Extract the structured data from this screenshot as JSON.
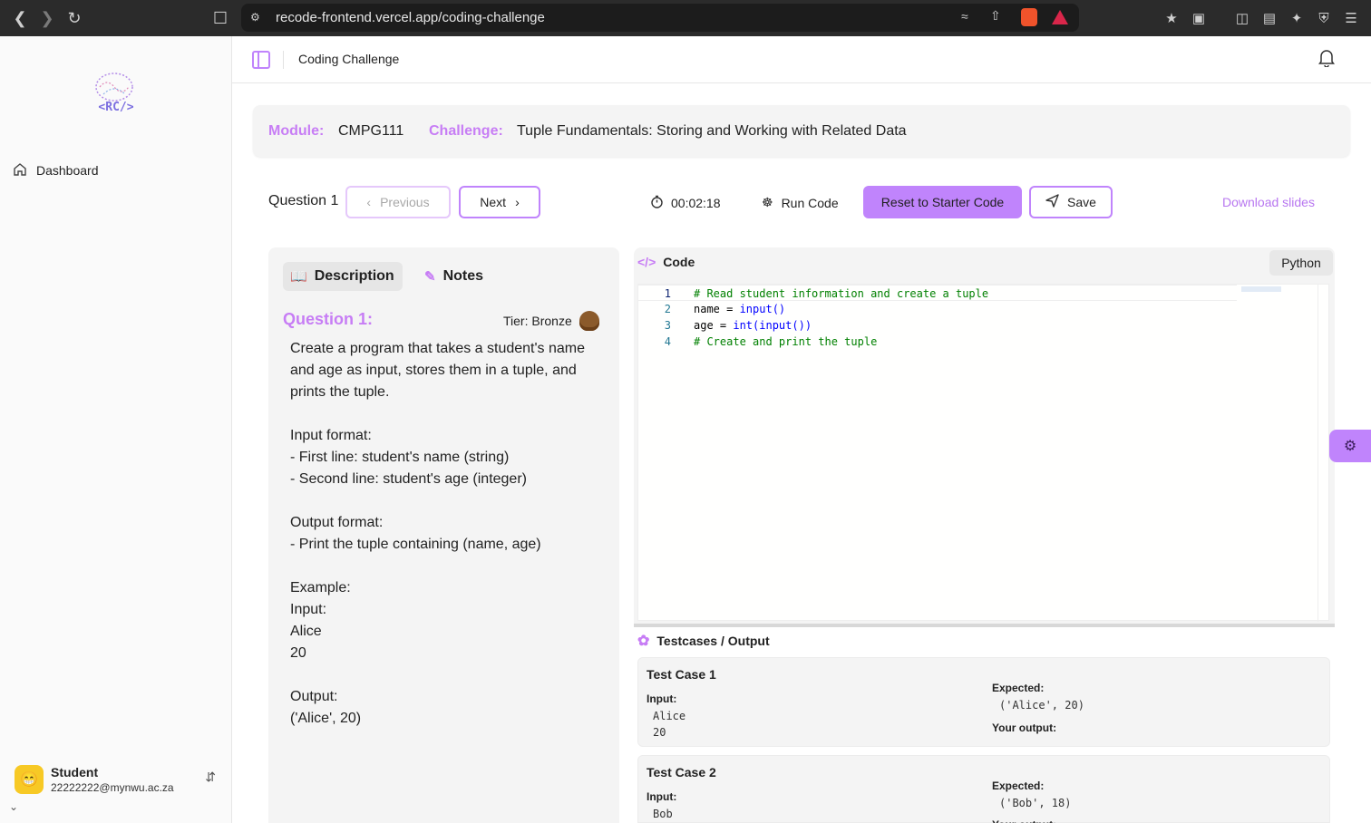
{
  "browser": {
    "url": "recode-frontend.vercel.app/coding-challenge"
  },
  "sidebar": {
    "logo_text": "<RC/>",
    "items": [
      {
        "label": "Dashboard",
        "icon": "home-icon"
      }
    ],
    "user": {
      "name": "Student",
      "email": "22222222@mynwu.ac.za"
    }
  },
  "header": {
    "title": "Coding Challenge"
  },
  "module_bar": {
    "module_label": "Module:",
    "module_value": "CMPG111",
    "challenge_label": "Challenge:",
    "challenge_value": "Tuple Fundamentals: Storing and Working with Related Data"
  },
  "toolbar": {
    "question_label": "Question 1",
    "previous_label": "Previous",
    "next_label": "Next",
    "timer": "00:02:18",
    "run_label": "Run Code",
    "reset_label": "Reset to Starter Code",
    "save_label": "Save",
    "download_label": "Download slides"
  },
  "description": {
    "tabs": [
      "Description",
      "Notes"
    ],
    "heading": "Question 1:",
    "tier": "Tier: Bronze",
    "lines": [
      "Create a program that takes a student's name and age as input, stores them in a tuple, and prints the tuple.",
      "",
      "Input format:",
      "- First line: student's name (string)",
      "- Second line: student's age (integer)",
      "",
      "Output format:",
      "- Print the tuple containing (name, age)",
      "",
      "Example:",
      "Input:",
      "Alice",
      "20",
      "",
      "Output:",
      "('Alice', 20)"
    ]
  },
  "code": {
    "title": "Code",
    "language": "Python",
    "lines": [
      {
        "num": "1",
        "segments": [
          [
            "cmt",
            "# Read student information and create a tuple"
          ]
        ]
      },
      {
        "num": "2",
        "segments": [
          [
            "",
            "name = "
          ],
          [
            "fn",
            "input()"
          ]
        ]
      },
      {
        "num": "3",
        "segments": [
          [
            "",
            "age = "
          ],
          [
            "fn",
            "int(input())"
          ]
        ]
      },
      {
        "num": "4",
        "segments": [
          [
            "cmt",
            "# Create and print the tuple"
          ]
        ]
      }
    ]
  },
  "testcases": {
    "title": "Testcases / Output",
    "input_label": "Input:",
    "expected_label": "Expected:",
    "output_label": "Your output:",
    "cases": [
      {
        "name": "Test Case 1",
        "input": "Alice\n20",
        "expected": "('Alice', 20)"
      },
      {
        "name": "Test Case 2",
        "input": "Bob",
        "expected": "('Bob', 18)"
      }
    ]
  },
  "colors": {
    "accent": "#c084fc",
    "accent_text": "#c77df5"
  }
}
